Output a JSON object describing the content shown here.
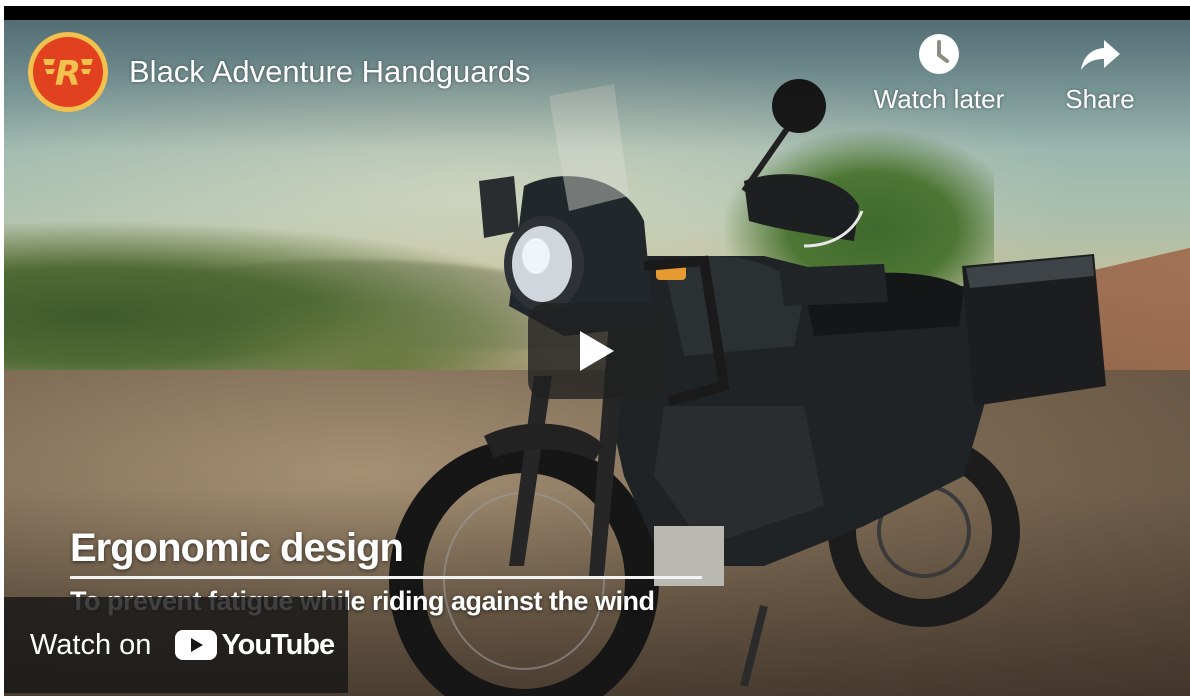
{
  "player": {
    "title": "Black Adventure Handguards",
    "channel_logo_icon": "royal-enfield-logo",
    "actions": {
      "watch_later_label": "Watch later",
      "watch_later_icon": "clock-icon",
      "share_label": "Share",
      "share_icon": "share-arrow-icon"
    },
    "play_icon": "play-icon"
  },
  "video_captions": {
    "headline": "Ergonomic design",
    "subline": "To prevent fatigue while riding against the wind"
  },
  "watch_on": {
    "label": "Watch on",
    "brand": "YouTube",
    "brand_icon": "youtube-icon"
  },
  "colors": {
    "overlay_bg": "#212121",
    "logo_ring": "#f2c14e",
    "logo_fill": "#e2411f",
    "youtube_red": "#ff0000"
  }
}
